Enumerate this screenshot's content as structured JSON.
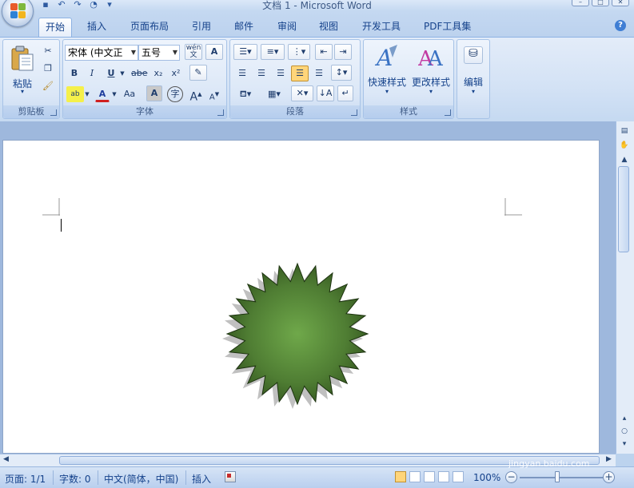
{
  "window": {
    "title": "文档 1 - Microsoft Word",
    "controls": [
      "minimize",
      "maximize",
      "close"
    ]
  },
  "quick_access": [
    "save-icon",
    "undo-icon",
    "redo-icon",
    "print-preview-icon",
    "customize-icon"
  ],
  "tabs": [
    {
      "label": "开始",
      "active": true
    },
    {
      "label": "插入"
    },
    {
      "label": "页面布局"
    },
    {
      "label": "引用"
    },
    {
      "label": "邮件"
    },
    {
      "label": "审阅"
    },
    {
      "label": "视图"
    },
    {
      "label": "开发工具"
    },
    {
      "label": "PDF工具集"
    }
  ],
  "ribbon": {
    "clipboard": {
      "group_label": "剪贴板",
      "paste_label": "粘贴"
    },
    "font": {
      "group_label": "字体",
      "font_name": "宋体 (中文正",
      "font_size": "五号",
      "bold": "B",
      "italic": "I",
      "underline": "U",
      "strike": "abe",
      "subscript": "x₂",
      "superscript": "x²",
      "change_case": "Aa",
      "grow": "A",
      "shrink": "A",
      "wen": "wén",
      "wen_char": "文",
      "char_shading": "A",
      "enclose": "字"
    },
    "paragraph": {
      "group_label": "段落"
    },
    "styles": {
      "group_label": "样式",
      "quick_styles_label": "快速样式",
      "change_styles_label": "更改样式"
    },
    "editing": {
      "edit_label": "编辑"
    }
  },
  "statusbar": {
    "page": "页面: 1/1",
    "words": "字数: 0",
    "language": "中文(简体，中国)",
    "mode": "插入",
    "zoom": "100%"
  },
  "document": {
    "shape": "24-point-star",
    "shape_fill": "#4a7a2f",
    "shape_center": "#6fa84a"
  },
  "watermark": {
    "brand": "Baidu经验",
    "url": "jingyan.baidu.com"
  }
}
